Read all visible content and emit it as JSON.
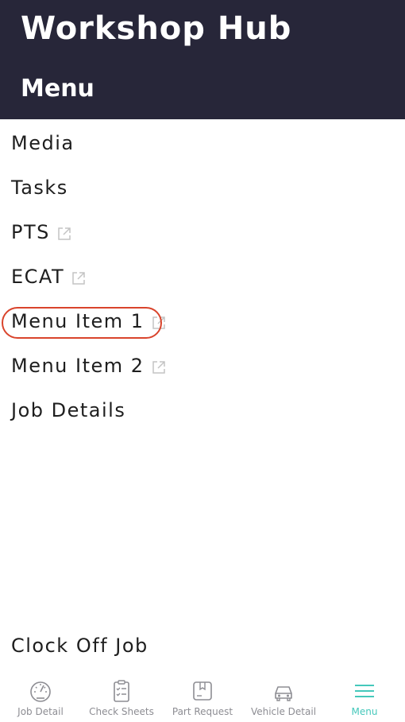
{
  "header": {
    "app_title": "Workshop Hub",
    "section_title": "Menu"
  },
  "menu": {
    "items": [
      {
        "label": "Media",
        "external": false
      },
      {
        "label": "Tasks",
        "external": false
      },
      {
        "label": "PTS",
        "external": true
      },
      {
        "label": "ECAT",
        "external": true
      },
      {
        "label": "Menu Item 1",
        "external": true,
        "highlighted": true
      },
      {
        "label": "Menu Item 2",
        "external": true
      },
      {
        "label": "Job Details",
        "external": false
      }
    ],
    "clock_off_label": "Clock Off Job"
  },
  "tabbar": {
    "tabs": [
      {
        "label": "Job Detail",
        "icon": "speedometer-icon",
        "active": false
      },
      {
        "label": "Check Sheets",
        "icon": "checklist-icon",
        "active": false
      },
      {
        "label": "Part Request",
        "icon": "package-icon",
        "active": false
      },
      {
        "label": "Vehicle Detail",
        "icon": "car-icon",
        "active": false
      },
      {
        "label": "Menu",
        "icon": "hamburger-icon",
        "active": true
      }
    ]
  },
  "colors": {
    "header_bg": "#272639",
    "accent": "#45c8bb",
    "highlight_ring": "#d9442c",
    "inactive_icon": "#8d8d93"
  }
}
